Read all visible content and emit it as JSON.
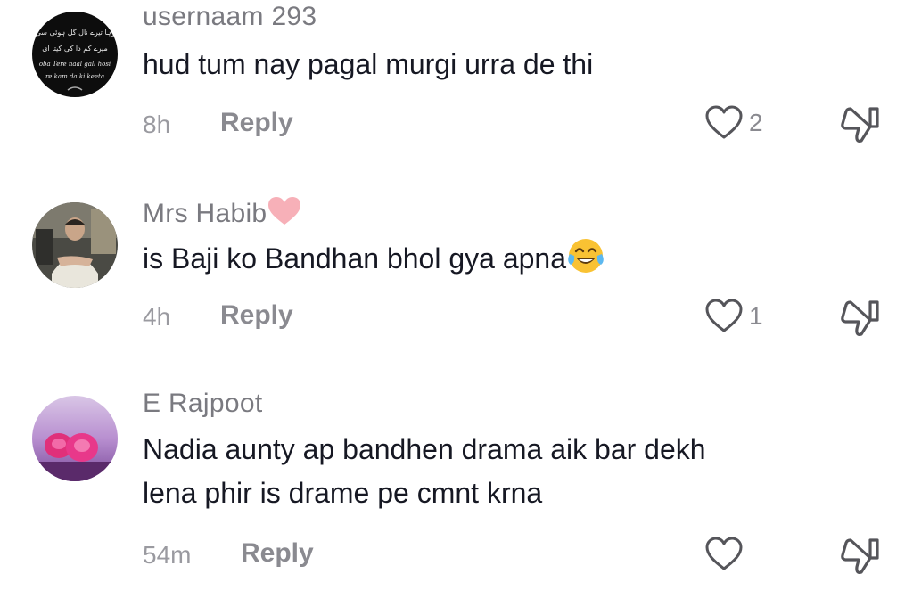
{
  "comments": [
    {
      "username": "usernaam 293",
      "text_lines": [
        "hud tum nay pagal murgi urra de thi"
      ],
      "time": "8h",
      "reply_label": "Reply",
      "likes": "2",
      "avatar_text": [
        "رہا تیرے نال گل ہوئی سی",
        "میرے کم دا کی کیتا ای",
        "oba Tere naal gall hosi",
        "re kam da ki keeta"
      ]
    },
    {
      "username": "Mrs Habib",
      "text_lines": [
        "is Baji ko Bandhan bhol gya apna"
      ],
      "time": "4h",
      "reply_label": "Reply",
      "likes": "1"
    },
    {
      "username": "E Rajpoot",
      "text_lines": [
        "Nadia aunty ap bandhen drama aik bar dekh",
        "lena phir is drame pe cmnt krna"
      ],
      "time": "54m",
      "reply_label": "Reply",
      "likes": ""
    }
  ],
  "icons": {
    "like": "heart-outline-icon",
    "dislike": "thumbs-down-icon",
    "name_emoji": "pink-heart-emoji",
    "text_emoji": "tears-of-joy-emoji"
  },
  "colors": {
    "username": "#7a7a80",
    "text": "#161823",
    "meta": "#8a8a90",
    "pink_heart": "#f7b0b8",
    "emoji_yellow": "#f9c233"
  }
}
